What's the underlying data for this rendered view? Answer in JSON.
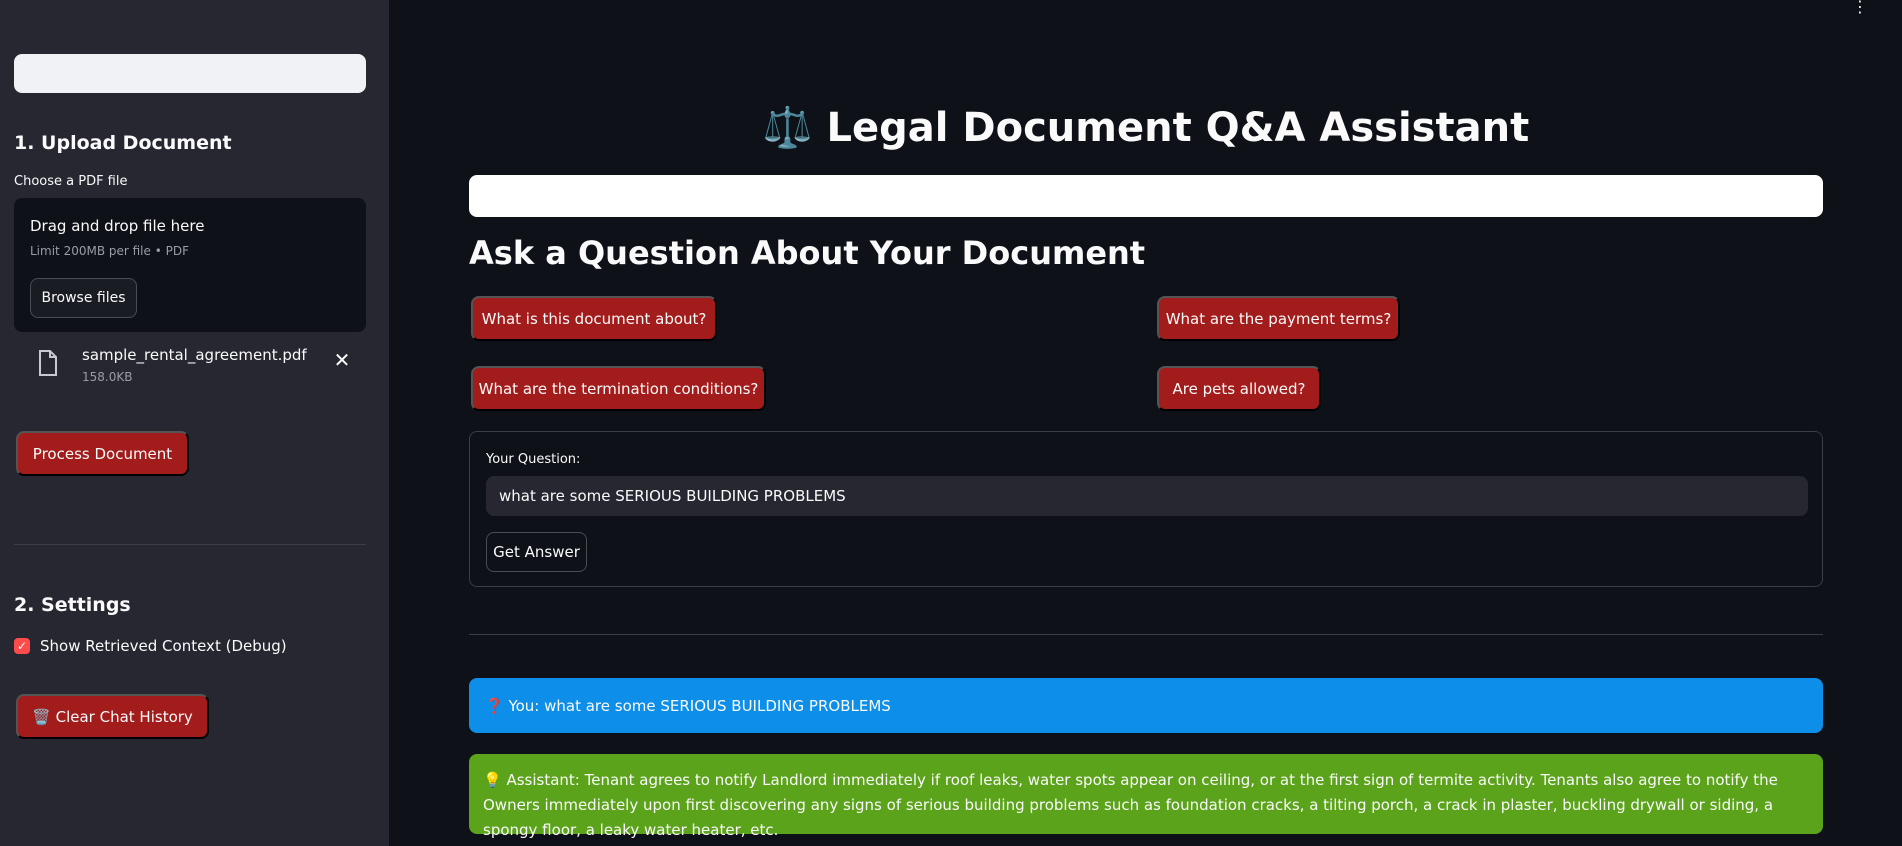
{
  "sidebar": {
    "upload_heading": "1. Upload Document",
    "file_label": "Choose a PDF file",
    "dropzone_title": "Drag and drop file here",
    "dropzone_limit": "Limit 200MB per file • PDF",
    "browse_label": "Browse files",
    "file": {
      "name": "sample_rental_agreement.pdf",
      "size": "158.0KB",
      "icon": "file-icon",
      "remove_icon": "close-icon"
    },
    "process_label": "Process Document",
    "settings_heading": "2. Settings",
    "debug_checkbox": {
      "label": "Show Retrieved Context (Debug)",
      "checked": true
    },
    "clear_label": "🗑️ Clear Chat History"
  },
  "header": {
    "title": "⚖️ Legal Document Q&A Assistant",
    "menu_icon": "kebab-menu-icon"
  },
  "main": {
    "ask_heading": "Ask a Question About Your Document",
    "quick_questions": [
      "What is this document about?",
      "What are the payment terms?",
      "What are the termination conditions?",
      "Are pets allowed?"
    ],
    "question_label": "Your Question:",
    "question_value": "what are some SERIOUS BUILDING PROBLEMS",
    "get_answer_label": "Get Answer"
  },
  "chat": {
    "user_message": "❓ You: what are some SERIOUS BUILDING PROBLEMS",
    "assistant_message": "💡 Assistant: Tenant agrees to notify Landlord immediately if roof leaks, water spots appear on ceiling, or at the first sign of termite activity. Tenants also agree to notify the Owners immediately upon first discovering any signs of serious building problems such as foundation cracks, a tilting porch, a crack in plaster, buckling drywall or siding, a spongy floor, a leaky water heater, etc."
  },
  "colors": {
    "sidebar_bg": "#262730",
    "main_bg": "#0e1117",
    "button_red": "#a31c1c",
    "user_msg_bg": "#0c8ee9",
    "assistant_msg_bg": "#5ba31a",
    "checkbox_accent": "#ff4b4b"
  }
}
